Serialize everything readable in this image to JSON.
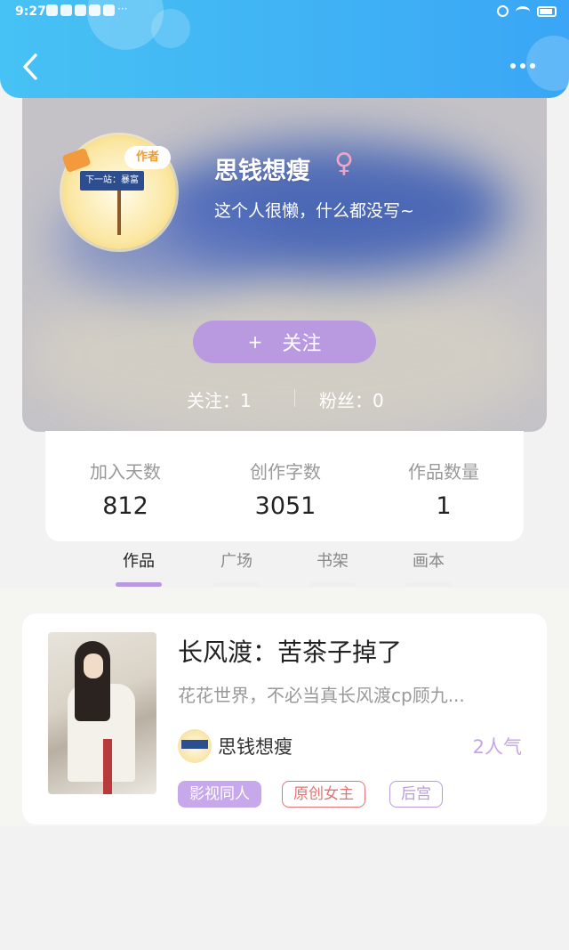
{
  "status_bar": {
    "time": "9:27",
    "more_indicator": "···"
  },
  "header": {
    "back_icon": "chevron-left-icon",
    "more_icon": "more-dots-icon"
  },
  "profile": {
    "name": "思钱想瘦",
    "gender_symbol": "♀",
    "bio": "这个人很懒，什么都没写~",
    "avatar_badge": "作者",
    "avatar_sign": "下一站：暴富",
    "follow_button_plus": "+",
    "follow_button_label": "关注",
    "following": "关注：1",
    "fans": "粉丝：0"
  },
  "stats": [
    {
      "label": "加入天数",
      "value": "812"
    },
    {
      "label": "创作字数",
      "value": "3051"
    },
    {
      "label": "作品数量",
      "value": "1"
    }
  ],
  "tabs": [
    {
      "label": "作品",
      "active": true
    },
    {
      "label": "广场",
      "active": false
    },
    {
      "label": "书架",
      "active": false
    },
    {
      "label": "画本",
      "active": false
    }
  ],
  "works": [
    {
      "title": "长风渡：苦茶子掉了",
      "description": "花花世界，不必当真长风渡cp顾九...",
      "author": "思钱想瘦",
      "popularity": "2人气",
      "tags": [
        "影视同人",
        "原创女主",
        "后宫"
      ]
    }
  ],
  "colors": {
    "header_blue": "#3aa6f5",
    "accent_purple": "#b99ae0",
    "tag_red": "#e57373"
  }
}
